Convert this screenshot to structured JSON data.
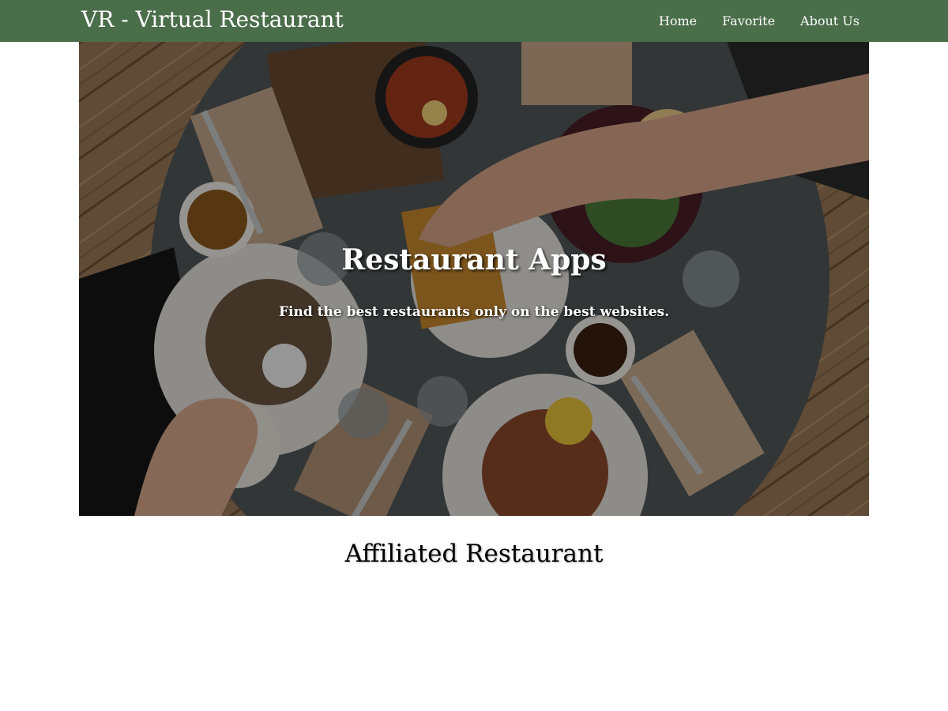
{
  "navbar": {
    "brand": "VR - Virtual Restaurant",
    "background_color": "#4a6e4a",
    "links": [
      {
        "label": "Home"
      },
      {
        "label": "Favorite"
      },
      {
        "label": "About Us"
      }
    ]
  },
  "hero": {
    "title": "Restaurant Apps",
    "subtitle": "Find the best restaurants only on the best websites."
  },
  "main": {
    "section_title": "Affiliated Restaurant"
  }
}
